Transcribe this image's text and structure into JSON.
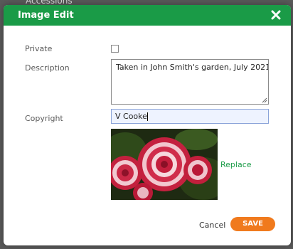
{
  "background": {
    "partial_text": "Accessions"
  },
  "dialog": {
    "title": "Image Edit",
    "close_icon": "close-icon",
    "accent_color": "#1a9b47"
  },
  "form": {
    "private": {
      "label": "Private",
      "checked": false
    },
    "description": {
      "label": "Description",
      "value": "Taken in John Smith's garden, July 2021"
    },
    "copyright": {
      "label": "Copyright",
      "value": "V Cooke"
    }
  },
  "image": {
    "replace_label": "Replace"
  },
  "footer": {
    "cancel_label": "Cancel",
    "save_label": "SAVE",
    "save_color": "#f07a1d"
  }
}
